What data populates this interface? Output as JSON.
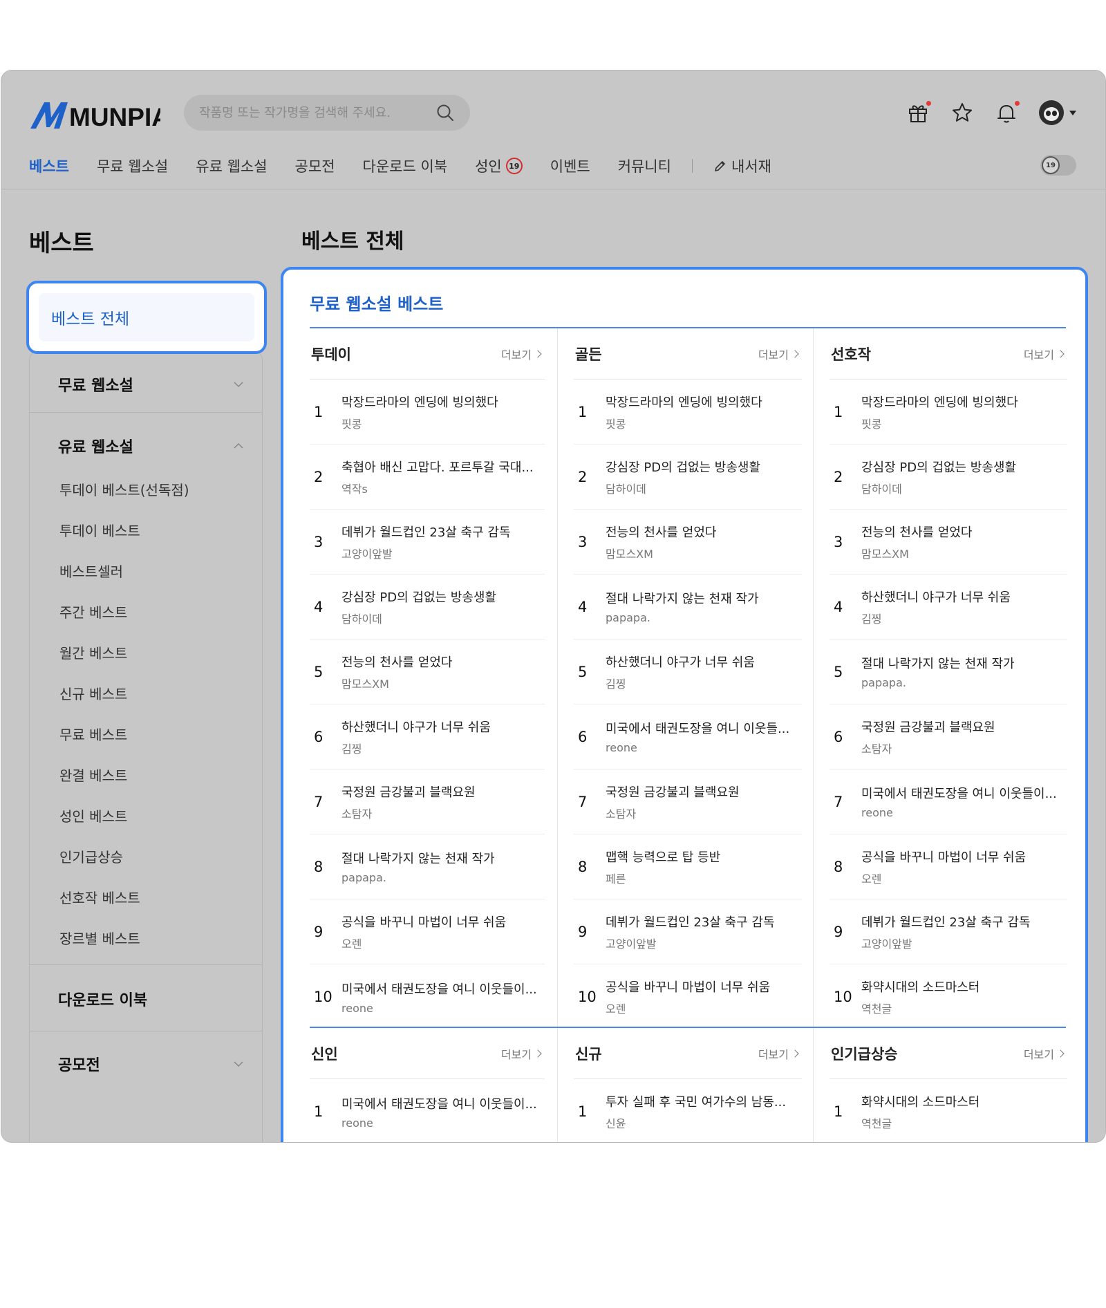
{
  "header": {
    "logo_text": "MUNPIA",
    "search": {
      "placeholder": "작품명 또는 작가명을 검색해 주세요.",
      "value": ""
    },
    "icons": [
      "gift-icon",
      "star-icon",
      "bell-icon",
      "avatar"
    ],
    "adult_badge": "19"
  },
  "nav": [
    {
      "label": "베스트",
      "active": true
    },
    {
      "label": "무료 웹소설"
    },
    {
      "label": "유료 웹소설"
    },
    {
      "label": "공모전"
    },
    {
      "label": "다운로드 이북"
    },
    {
      "label": "성인",
      "badge": "19"
    },
    {
      "label": "이벤트"
    },
    {
      "label": "커뮤니티"
    },
    {
      "label": "내서재",
      "icon": "pen-icon"
    }
  ],
  "sidebar": {
    "title": "베스트",
    "active": "베스트 전체",
    "free": "무료 웹소설",
    "paid": "유료 웹소설",
    "paid_items": [
      "투데이 베스트(선독점)",
      "투데이 베스트",
      "베스트셀러",
      "주간 베스트",
      "월간 베스트",
      "신규 베스트",
      "무료 베스트",
      "완결 베스트",
      "성인 베스트",
      "인기급상승",
      "선호작 베스트",
      "장르별 베스트"
    ],
    "download": "다운로드 이북",
    "contest": "공모전"
  },
  "main": {
    "title": "베스트 전체",
    "panel_title": "무료 웹소설 베스트",
    "more_label": "더보기",
    "columns": [
      {
        "name": "투데이",
        "items": [
          {
            "rank": "1",
            "title": "막장드라마의 엔딩에 빙의했다",
            "author": "핏콩"
          },
          {
            "rank": "2",
            "title": "축협아 배신 고맙다. 포르투갈 국대...",
            "author": "역작s"
          },
          {
            "rank": "3",
            "title": "데뷔가 월드컵인 23살 축구 감독",
            "author": "고양이앞발"
          },
          {
            "rank": "4",
            "title": "강심장 PD의 겁없는 방송생활",
            "author": "담하이데"
          },
          {
            "rank": "5",
            "title": "전능의 천사를 얻었다",
            "author": "맘모스XM"
          },
          {
            "rank": "6",
            "title": "하산했더니 야구가 너무 쉬움",
            "author": "김찡"
          },
          {
            "rank": "7",
            "title": "국정원 금강불괴 블랙요원",
            "author": "소탐자"
          },
          {
            "rank": "8",
            "title": "절대 나락가지 않는 천재 작가",
            "author": "papapa."
          },
          {
            "rank": "9",
            "title": "공식을 바꾸니 마법이 너무 쉬움",
            "author": "오렌"
          },
          {
            "rank": "10",
            "title": "미국에서 태권도장을 여니 이웃들이...",
            "author": "reone"
          }
        ]
      },
      {
        "name": "골든",
        "items": [
          {
            "rank": "1",
            "title": "막장드라마의 엔딩에 빙의했다",
            "author": "핏콩"
          },
          {
            "rank": "2",
            "title": "강심장 PD의 겁없는 방송생활",
            "author": "담하이데"
          },
          {
            "rank": "3",
            "title": "전능의 천사를 얻었다",
            "author": "맘모스XM"
          },
          {
            "rank": "4",
            "title": "절대 나락가지 않는 천재 작가",
            "author": "papapa."
          },
          {
            "rank": "5",
            "title": "하산했더니 야구가 너무 쉬움",
            "author": "김찡"
          },
          {
            "rank": "6",
            "title": "미국에서 태권도장을 여니 이웃들...",
            "author": "reone"
          },
          {
            "rank": "7",
            "title": "국정원 금강불괴 블랙요원",
            "author": "소탐자"
          },
          {
            "rank": "8",
            "title": "맵핵 능력으로 탑 등반",
            "author": "페른"
          },
          {
            "rank": "9",
            "title": "데뷔가 월드컵인 23살 축구 감독",
            "author": "고양이앞발"
          },
          {
            "rank": "10",
            "title": "공식을 바꾸니 마법이 너무 쉬움",
            "author": "오렌"
          }
        ]
      },
      {
        "name": "선호작",
        "items": [
          {
            "rank": "1",
            "title": "막장드라마의 엔딩에 빙의했다",
            "author": "핏콩"
          },
          {
            "rank": "2",
            "title": "강심장 PD의 겁없는 방송생활",
            "author": "담하이데"
          },
          {
            "rank": "3",
            "title": "전능의 천사를 얻었다",
            "author": "맘모스XM"
          },
          {
            "rank": "4",
            "title": "하산했더니 야구가 너무 쉬움",
            "author": "김찡"
          },
          {
            "rank": "5",
            "title": "절대 나락가지 않는 천재 작가",
            "author": "papapa."
          },
          {
            "rank": "6",
            "title": "국정원 금강불괴 블랙요원",
            "author": "소탐자"
          },
          {
            "rank": "7",
            "title": "미국에서 태권도장을 여니 이웃들이...",
            "author": "reone"
          },
          {
            "rank": "8",
            "title": "공식을 바꾸니 마법이 너무 쉬움",
            "author": "오렌"
          },
          {
            "rank": "9",
            "title": "데뷔가 월드컵인 23살 축구 감독",
            "author": "고양이앞발"
          },
          {
            "rank": "10",
            "title": "화약시대의 소드마스터",
            "author": "역천글"
          }
        ]
      }
    ],
    "columns2": [
      {
        "name": "신인",
        "items": [
          {
            "rank": "1",
            "title": "미국에서 태권도장을 여니 이웃들이...",
            "author": "reone"
          }
        ]
      },
      {
        "name": "신규",
        "items": [
          {
            "rank": "1",
            "title": "투자 실패 후 국민 여가수의 남동...",
            "author": "신윤"
          }
        ]
      },
      {
        "name": "인기급상승",
        "items": [
          {
            "rank": "1",
            "title": "화약시대의 소드마스터",
            "author": "역천글"
          }
        ]
      }
    ]
  }
}
